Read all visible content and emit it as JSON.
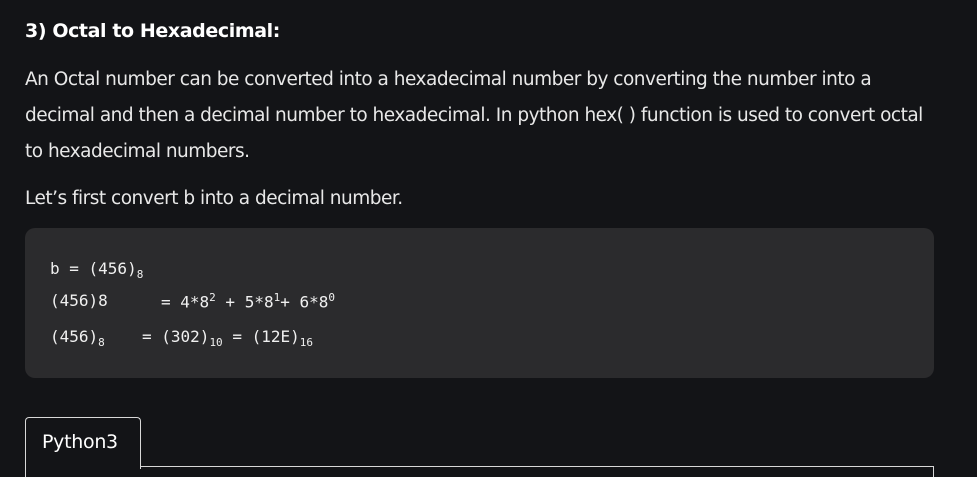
{
  "article": {
    "heading": "3) Octal to Hexadecimal:",
    "paragraph_1": "An Octal number can be converted into a hexadecimal number by converting the number into a decimal and then a decimal number to hexadecimal. In python hex( ) function is used to convert octal to hexadecimal numbers.",
    "paragraph_2": "Let’s first convert b into a decimal number."
  },
  "code_block": {
    "line_1": {
      "lhs": "b = (456)",
      "base": "8"
    },
    "line_2": {
      "lhs": "(456)8",
      "eq": "= 4*8",
      "exp_1": "2",
      "mid_1": " + 5*8",
      "exp_2": "1",
      "mid_2": "+ 6*8",
      "exp_3": "0"
    },
    "line_3": {
      "lhs": "(456)",
      "lhs_base": "8",
      "eq_1": "= (302)",
      "dec_base": "10",
      "eq_2": " = (12E)",
      "hex_base": "16"
    }
  },
  "tabs": [
    {
      "label": "Python3",
      "active": true
    }
  ]
}
